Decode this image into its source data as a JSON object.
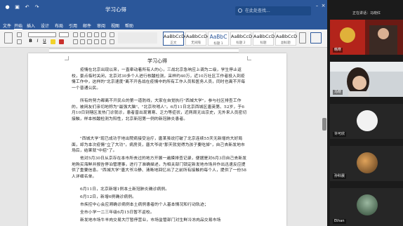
{
  "window": {
    "title": "学习心得"
  },
  "search": {
    "placeholder": "在此处查找..."
  },
  "ribbon": {
    "tabs": [
      "文件",
      "开始",
      "插入",
      "设计",
      "布局",
      "引用",
      "邮件",
      "审阅",
      "视图",
      "帮助"
    ],
    "styles": [
      {
        "sample": "AaBbCcDd",
        "name": "正文"
      },
      {
        "sample": "AaBbCcDd",
        "name": "无间隔"
      },
      {
        "sample": "AaBbC",
        "name": "标题 1"
      },
      {
        "sample": "AaBbCcD",
        "name": "标题 2"
      },
      {
        "sample": "AaBbCcD",
        "name": "标题"
      },
      {
        "sample": "AaBbCcD",
        "name": "副标题"
      }
    ]
  },
  "document": {
    "title": "学习心得",
    "paragraphs": [
      "疫情在北京出现以来，一直牵动着所有人的心，三战北京急响应上调为二级，学生停止返校，景点临时关闭，北京对30多个人进行核酸检测，采样约40万，近10万社区工作者投入到疫情工作中，这样的\"北京速度\"离不开各战在疫情中的所有工作人员和医务人员，同时也离不开每一个普通公民。",
      "所有的努力都离不开民众的第一道防线，大家在自觉执行\"西城大学\"，参与社区排查工作的，被网友们亲切地称为\"最强大脑\"、\"北京吹哨人\"。6月11日北京西城区唐英第、52岁，于6月10日到辖区发热门诊就诊，患者曾出现胃寒、乏力等症状，近两周无出京史，无外来人员密切接触，样本核酸检测为阳性，北京新冠第一例的新冠肺炎患者。",
      "\"西城大学\"现已成功于地出院病接受治疗，唐某虽说打破了北京连续55天无新增的大好局面，却为本次疫情\"立了大功\"，病房员，唐大爷说\"那天就觉得为孩子要吃掉\"，自己去新发地市场后，结果就\"中招\"了。",
      "他对5月30日从京存在本市所去过的地方开展一遍摸排查记录，便据是对6月3日自己去新发地购买海鲜并报告停泊管理事，进行了准确描述，为相关部门锁定新发地市场并作出迅速反应提供了重要信息。\"西城大学\"唐大爷冷静、清晰地回忆出了之前所有接触的每个人，提供了一份58人详细名单。"
    ],
    "list": [
      "6月11日，北京新增1例本土新冠肺炎确诊病例。",
      "6月12日，新增6例确诊病例。",
      "市疾控中心会应溯确诊病例本土病例患者的个人基本情况和行动轨迹；",
      "全市小学一二三年级6月15日暂不返校。",
      "新发地市场牛羊肉交易大厅暂停营业，市场监管部门对生鲜冷冻肉品交易市场"
    ]
  },
  "meeting": {
    "speaker": "正在讲话：马晓红",
    "participants": [
      {
        "name": "韩寒"
      },
      {
        "name": "马晓"
      },
      {
        "name": "许可欣"
      },
      {
        "name": "孙科晨"
      },
      {
        "name": "Ethan"
      }
    ]
  },
  "colors": {
    "word_blue": "#2b579a",
    "panel_bg": "#1b1b1b"
  }
}
